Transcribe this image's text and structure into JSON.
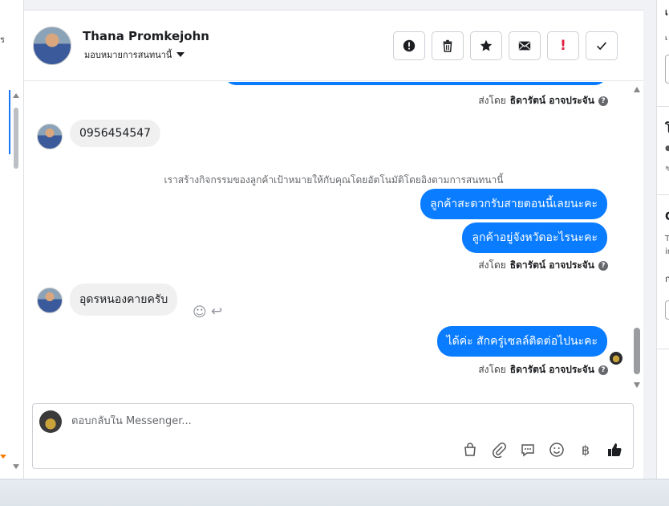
{
  "left_panel": {
    "fragment": "ร"
  },
  "header": {
    "contact_name": "Thana Promkejohn",
    "assign_label": "มอบหมายการสนทนานี้"
  },
  "toolbar": {
    "buttons": [
      {
        "name": "mark-spam-button",
        "icon": "alert-circle-icon"
      },
      {
        "name": "delete-button",
        "icon": "trash-icon"
      },
      {
        "name": "star-button",
        "icon": "star-icon"
      },
      {
        "name": "mark-unread-button",
        "icon": "envelope-icon"
      },
      {
        "name": "follow-up-button",
        "icon": "exclamation-icon",
        "glyph": "!"
      },
      {
        "name": "mark-done-button",
        "icon": "check-icon"
      }
    ]
  },
  "messages": {
    "sent_by_prefix": "ส่งโดย",
    "agent_name": "ธิดารัตน์ อาจประจัน",
    "incoming_1": "0956454547",
    "system_note": "เราสร้างกิจกรรมของลูกค้าเป้าหมายให้กับคุณโดยอัตโนมัติโดยอิงตามการสนทนานี้",
    "outgoing_1": "ลูกค้าสะดวกรับสายตอนนี้เลยนะคะ",
    "outgoing_2": "ลูกค้าอยู่จังหวัดอะไรนะคะ",
    "incoming_2": "อุดรหนองคายครับ",
    "outgoing_3": "ได้ค่ะ สักครู่เซลล์ติดต่อไปนะคะ"
  },
  "composer": {
    "placeholder": "ตอบกลับใน Messenger...",
    "icons": [
      "shopping-bag-icon",
      "paperclip-icon",
      "saved-reply-icon",
      "emoji-icon",
      "baht-icon",
      "thumbs-up-icon"
    ]
  },
  "right_panel": {
    "fragments": [
      "เ",
      "เ",
      "โ",
      "C",
      "T",
      "in",
      "ก"
    ]
  },
  "colors": {
    "accent": "#0a7cff",
    "follow_up_red": "#e41e3f",
    "bubble_in": "#f0f0f0"
  }
}
